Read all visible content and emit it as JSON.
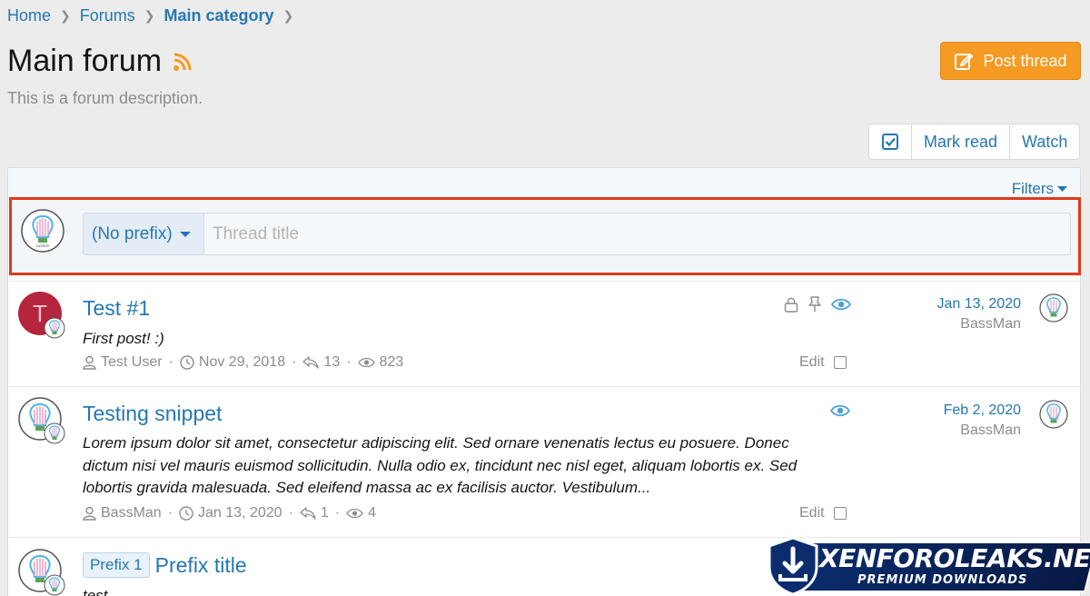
{
  "breadcrumb": {
    "items": [
      "Home",
      "Forums",
      "Main category"
    ]
  },
  "page": {
    "title": "Main forum",
    "description": "This is a forum description."
  },
  "actions": {
    "post_thread": "Post thread",
    "mark_read": "Mark read",
    "watch": "Watch"
  },
  "filters": {
    "label": "Filters"
  },
  "quick_thread": {
    "prefix": "(No prefix)",
    "title_placeholder": "Thread title"
  },
  "threads": [
    {
      "avatar_letter": "T",
      "title": "Test #1",
      "snippet": "First post! :)",
      "author": "Test User",
      "date": "Nov 29, 2018",
      "replies": "13",
      "views": "823",
      "edit": "Edit",
      "latest_date": "Jan 13, 2020",
      "latest_user": "BassMan",
      "icons": [
        "lock-icon",
        "pin-icon",
        "eye-icon"
      ]
    },
    {
      "title": "Testing snippet",
      "snippet": "Lorem ipsum dolor sit amet, consectetur adipiscing elit. Sed ornare venenatis lectus eu posuere. Donec dictum nisi vel mauris euismod sollicitudin. Nulla odio ex, tincidunt nec nisl eget, aliquam lobortis ex. Sed lobortis gravida malesuada. Sed eleifend massa ac ex facilisis auctor. Vestibulum...",
      "author": "BassMan",
      "date": "Jan 13, 2020",
      "replies": "1",
      "views": "4",
      "edit": "Edit",
      "latest_date": "Feb 2, 2020",
      "latest_user": "BassMan",
      "icons": [
        "eye-icon"
      ]
    },
    {
      "prefix": "Prefix 1",
      "title": "Prefix title",
      "snippet": "test"
    }
  ],
  "watermark": {
    "title": "XENFOROLEAKS.NET",
    "subtitle": "PREMIUM DOWNLOADS"
  },
  "colors": {
    "link": "#2577b1",
    "button": "#f59a22",
    "highlight_border": "#e0391c",
    "muted": "#8c8c8c"
  }
}
